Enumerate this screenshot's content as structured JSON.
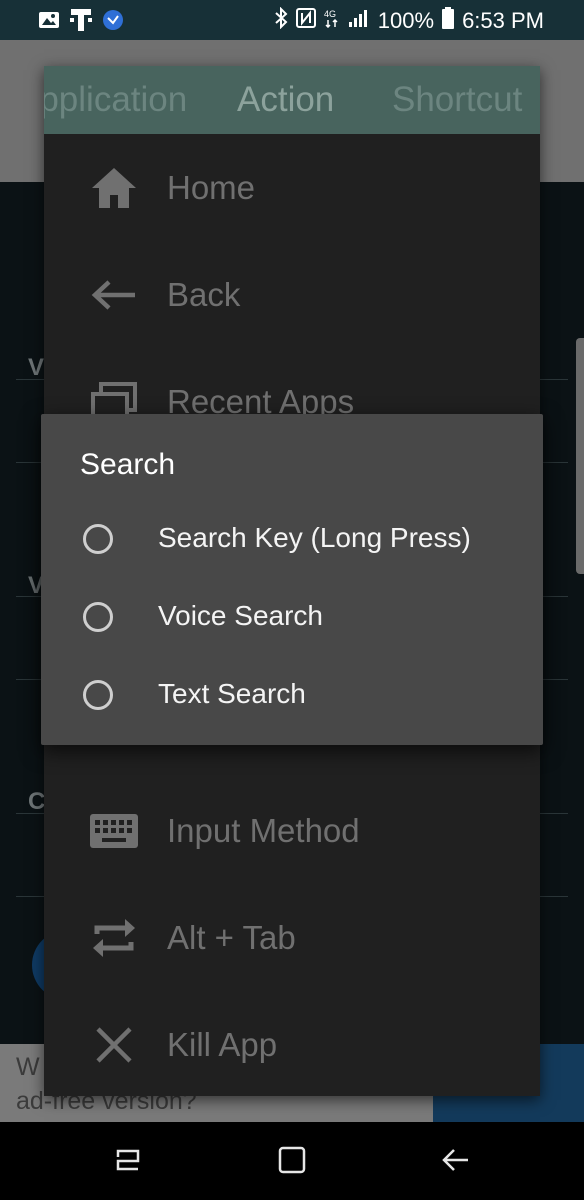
{
  "status_bar": {
    "battery_percent": "100%",
    "time": "6:53 PM",
    "icons": [
      "gallery-icon",
      "t-mobile-icon",
      "app-notification-icon",
      "bluetooth-icon",
      "nfc-icon",
      "lte-icon",
      "signal-icon",
      "battery-icon"
    ]
  },
  "background": {
    "letters": [
      "V",
      "V",
      "C"
    ],
    "banner_text_line1": "W",
    "banner_text_line2": "ad-free version?"
  },
  "sheet": {
    "tabs": [
      "Application",
      "Action",
      "Shortcut"
    ],
    "active_tab": "Action",
    "items": [
      {
        "label": "Home",
        "icon": "home-icon"
      },
      {
        "label": "Back",
        "icon": "arrow-back-icon"
      },
      {
        "label": "Recent Apps",
        "icon": "recent-apps-icon"
      },
      {
        "label": "Input Method",
        "icon": "keyboard-icon"
      },
      {
        "label": "Alt + Tab",
        "icon": "swap-icon"
      },
      {
        "label": "Kill App",
        "icon": "close-icon"
      }
    ]
  },
  "dialog": {
    "title": "Search",
    "options": [
      {
        "label": "Search Key (Long Press)",
        "selected": false
      },
      {
        "label": "Voice Search",
        "selected": false
      },
      {
        "label": "Text Search",
        "selected": false
      }
    ]
  },
  "nav_bar": {
    "buttons": [
      "recents-icon",
      "home-icon",
      "back-icon"
    ]
  },
  "colors": {
    "status_bar": "#173037",
    "tab_bar": "#48645e",
    "sheet": "#202020",
    "dialog": "#484848"
  }
}
